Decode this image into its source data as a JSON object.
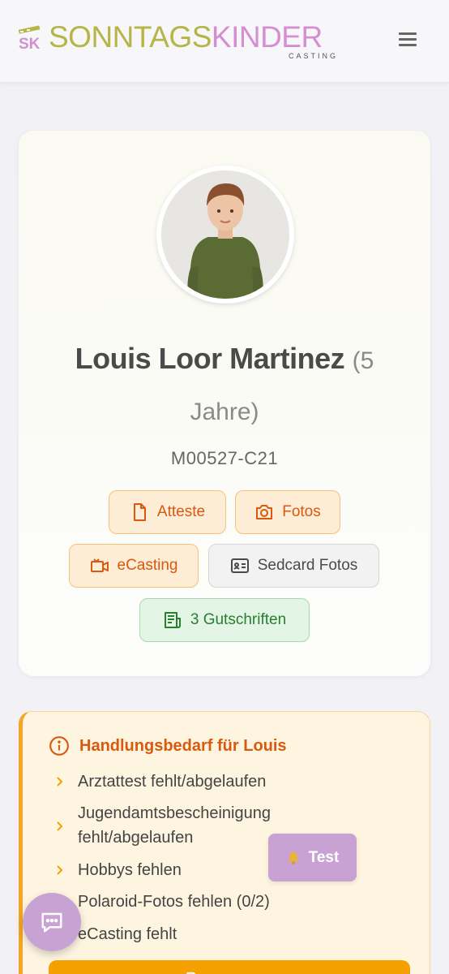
{
  "brand": {
    "word1": "SONNTAGS",
    "word2": "KINDER",
    "subtitle": "CASTING",
    "accent_olive": "#b5b54a",
    "accent_pink": "#d48fd2"
  },
  "header": {
    "menu_icon": "hamburger-menu-icon"
  },
  "profile": {
    "name": "Louis Loor Martinez",
    "age_part1": "(5",
    "age_part2": "Jahre)",
    "model_id": "M00527-C21",
    "buttons": {
      "atteste": "Atteste",
      "fotos": "Fotos",
      "ecasting": "eCasting",
      "sedcard": "Sedcard Fotos",
      "gutschriften": "3 Gutschriften"
    }
  },
  "action": {
    "title": "Handlungsbedarf für Louis",
    "items": [
      "Arztattest fehlt/abgelaufen",
      "Jugendamtsbescheinigung",
      "fehlt/abgelaufen",
      "Hobbys fehlen",
      "Polaroid-Fotos fehlen (0/2)",
      "eCasting fehlt"
    ]
  },
  "floating": {
    "test_label": "Test",
    "test_icon": "bell-icon",
    "chat_icon": "chat-icon"
  },
  "colors": {
    "orange_text": "#d8590f",
    "orange_button": "#f5a000",
    "green_text": "#2a7d31",
    "lilac": "#c9a2d4"
  }
}
